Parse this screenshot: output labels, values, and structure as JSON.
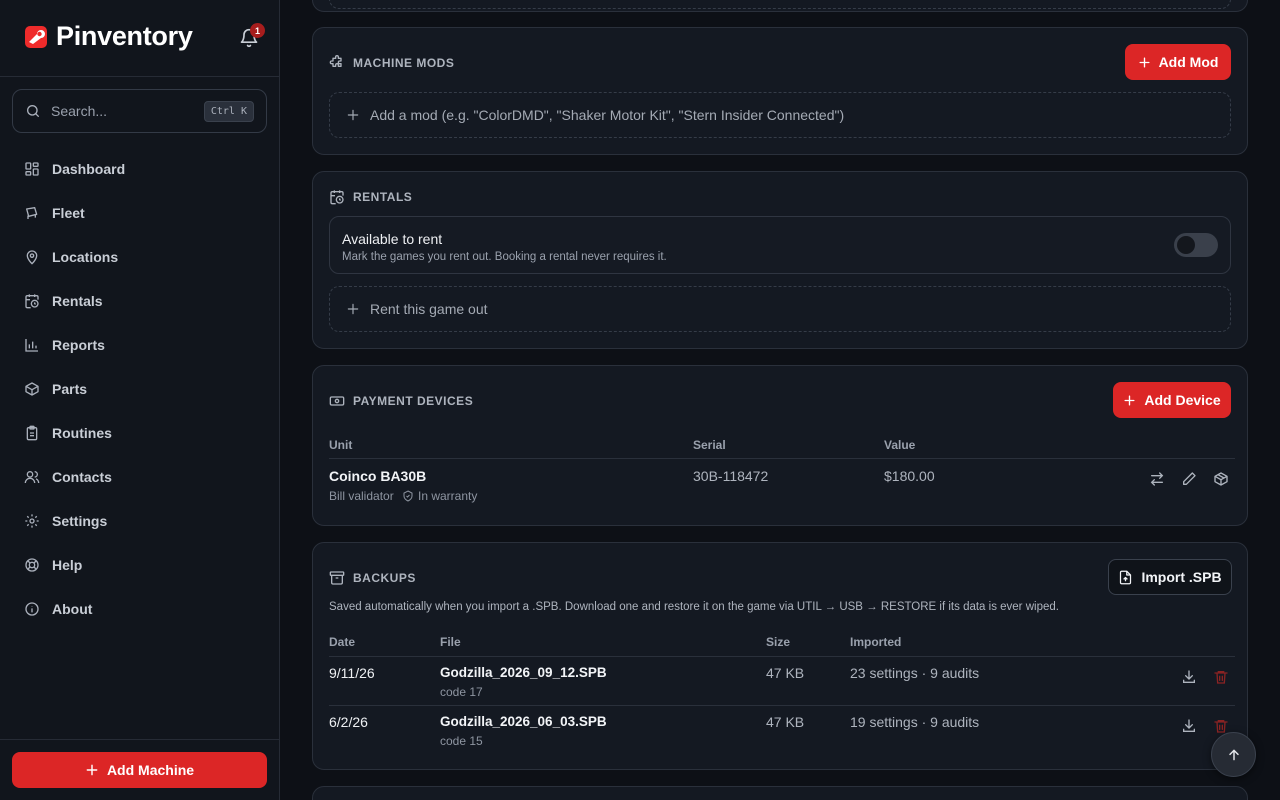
{
  "app": {
    "name": "Pinventory",
    "notification_count": "1"
  },
  "search": {
    "placeholder": "Search...",
    "shortcut": "Ctrl K"
  },
  "nav": [
    {
      "label": "Dashboard",
      "icon": "dashboard-icon"
    },
    {
      "label": "Fleet",
      "icon": "fleet-icon"
    },
    {
      "label": "Locations",
      "icon": "map-pin-icon"
    },
    {
      "label": "Rentals",
      "icon": "calendar-clock-icon"
    },
    {
      "label": "Reports",
      "icon": "bar-chart-icon"
    },
    {
      "label": "Parts",
      "icon": "package-icon"
    },
    {
      "label": "Routines",
      "icon": "clipboard-icon"
    },
    {
      "label": "Contacts",
      "icon": "users-icon"
    },
    {
      "label": "Settings",
      "icon": "gear-icon"
    },
    {
      "label": "Help",
      "icon": "life-buoy-icon"
    },
    {
      "label": "About",
      "icon": "info-icon"
    }
  ],
  "add_machine": "Add Machine",
  "mods": {
    "title": "MACHINE MODS",
    "add_button": "Add Mod",
    "placeholder": "Add a mod (e.g. \"ColorDMD\", \"Shaker Motor Kit\", \"Stern Insider Connected\")"
  },
  "rentals": {
    "title": "RENTALS",
    "available_label": "Available to rent",
    "available_sub": "Mark the games you rent out. Booking a rental never requires it.",
    "rent_out": "Rent this game out",
    "available": false
  },
  "payment": {
    "title": "PAYMENT DEVICES",
    "add_button": "Add Device",
    "headers": {
      "unit": "Unit",
      "serial": "Serial",
      "value": "Value"
    },
    "rows": [
      {
        "unit": "Coinco BA30B",
        "type": "Bill validator",
        "warranty": "In warranty",
        "serial": "30B-118472",
        "value": "$180.00"
      }
    ]
  },
  "backups": {
    "title": "BACKUPS",
    "import_button": "Import .SPB",
    "description": "Saved automatically when you import a .SPB. Download one and restore it on the game via UTIL → USB → RESTORE if its data is ever wiped.",
    "headers": {
      "date": "Date",
      "file": "File",
      "size": "Size",
      "imported": "Imported"
    },
    "rows": [
      {
        "date": "9/11/26",
        "file": "Godzilla_2026_09_12.SPB",
        "code": "code 17",
        "size": "47 KB",
        "imported": "23 settings · 9 audits"
      },
      {
        "date": "6/2/26",
        "file": "Godzilla_2026_06_03.SPB",
        "code": "code 15",
        "size": "47 KB",
        "imported": "19 settings · 9 audits"
      }
    ]
  },
  "colors": {
    "accent": "#dc2626",
    "background": "#0d1016",
    "card": "#141922"
  }
}
